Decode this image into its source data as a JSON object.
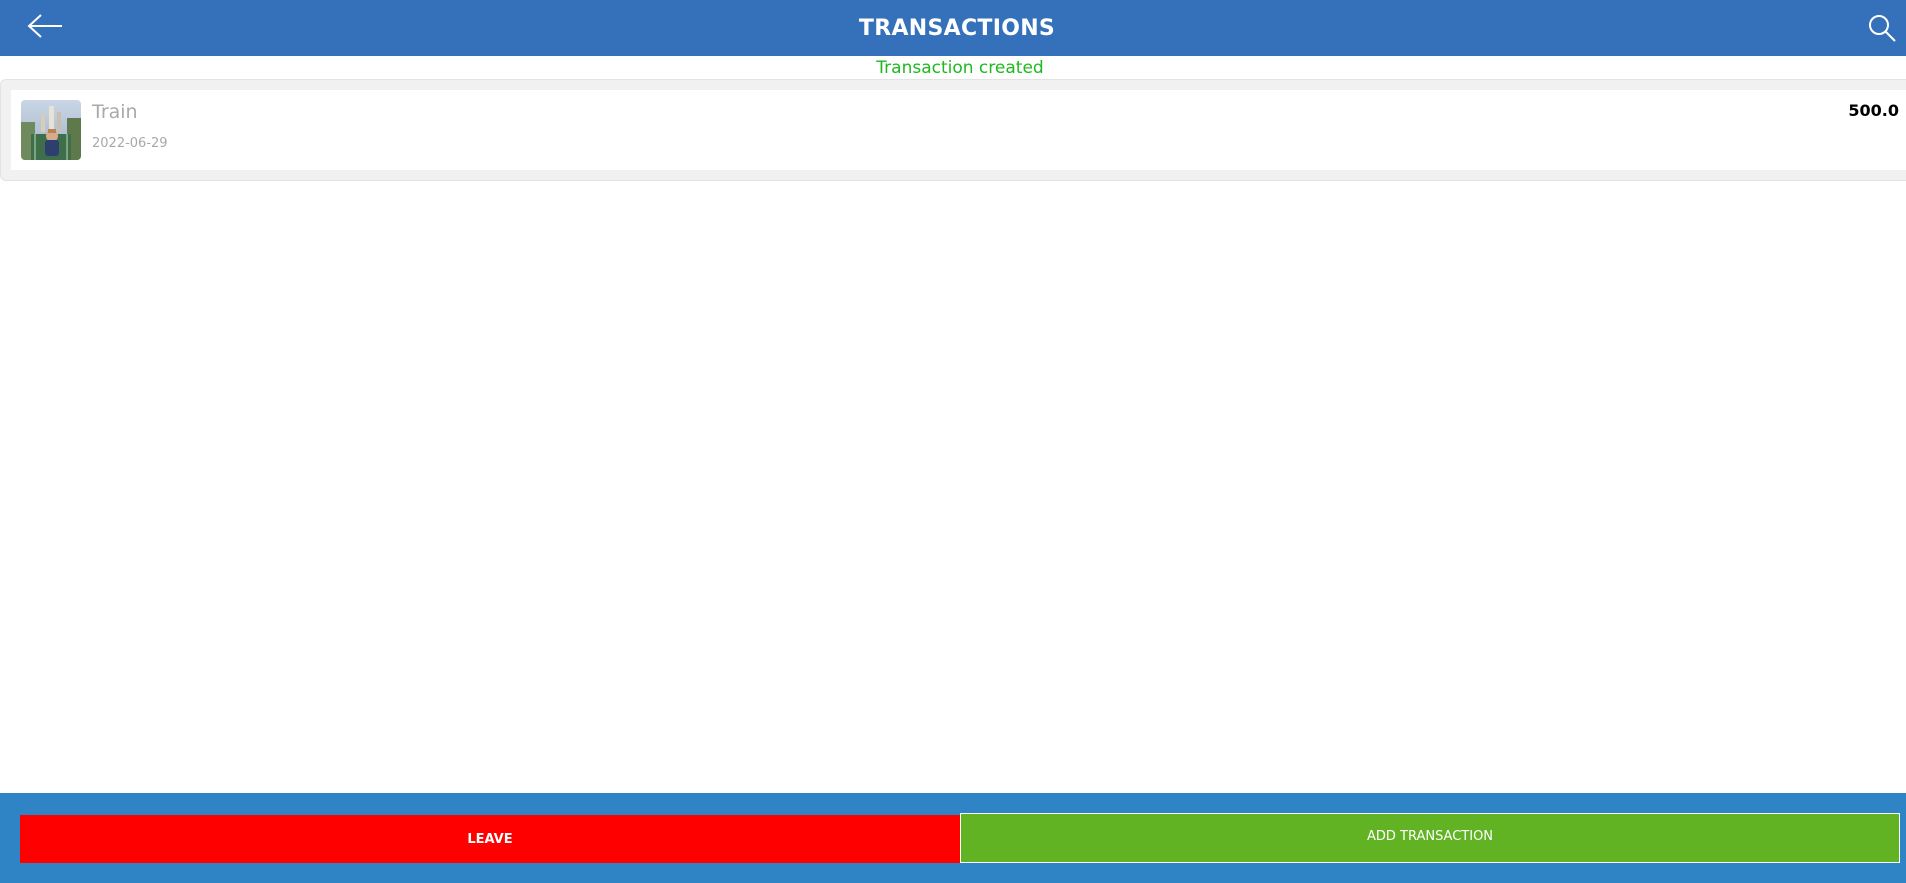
{
  "header": {
    "title": "TRANSACTIONS",
    "back_icon": "arrow-left-icon",
    "search_icon": "search-icon",
    "background_color": "#3570bb"
  },
  "status": {
    "message": "Transaction created",
    "color": "#1fb81f"
  },
  "transactions": [
    {
      "name": "Train",
      "date": "2022-06-29",
      "amount": "500.0",
      "thumbnail_icon": "photo-thumbnail"
    }
  ],
  "footer": {
    "leave_label": "LEAVE",
    "leave_color": "#ff0000",
    "add_label": "ADD TRANSACTION",
    "add_color": "#62b324",
    "background_color": "#2f84c6"
  }
}
